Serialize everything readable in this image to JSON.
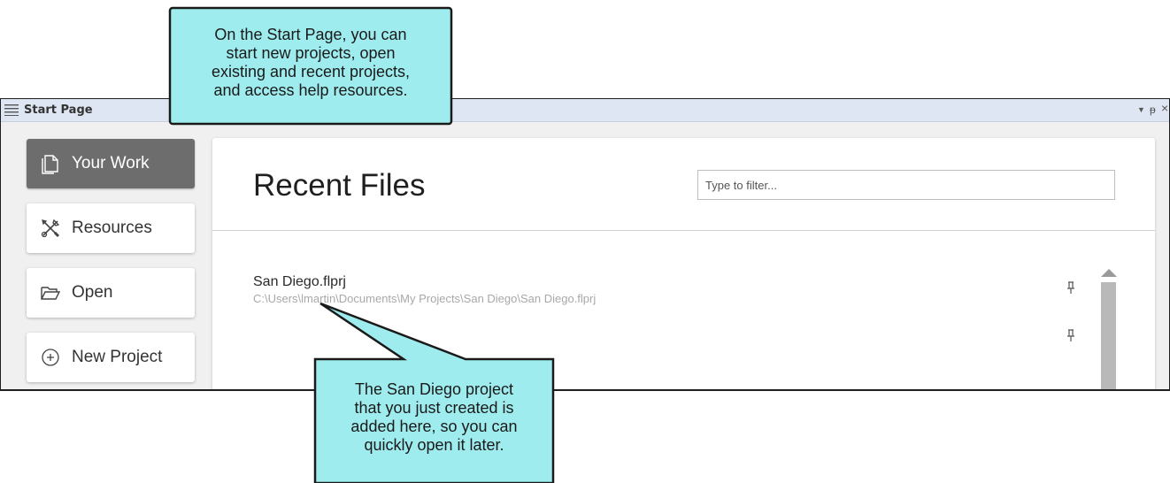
{
  "window": {
    "title": "Start Page",
    "controls": {
      "dropdown": "▼",
      "pin": "ᵽ",
      "close": "×"
    }
  },
  "sidebar": {
    "items": [
      {
        "label": "Your Work",
        "icon": "document-icon",
        "active": true
      },
      {
        "label": "Resources",
        "icon": "tools-icon",
        "active": false
      },
      {
        "label": "Open",
        "icon": "folder-open-icon",
        "active": false
      },
      {
        "label": "New Project",
        "icon": "plus-circle-icon",
        "active": false
      }
    ]
  },
  "main": {
    "title": "Recent Files",
    "filter_placeholder": "Type to filter...",
    "recent_files": [
      {
        "name": "San Diego.flprj",
        "path": "C:\\Users\\lmartin\\Documents\\My Projects\\San Diego\\San Diego.flprj"
      }
    ]
  },
  "callouts": {
    "top": {
      "lines": [
        "On the Start Page, you can",
        "start new projects, open",
        "existing and recent projects,",
        "and access help resources."
      ],
      "fill": "#9eecee"
    },
    "bottom": {
      "lines": [
        "The San Diego project",
        "that you just created is",
        "added here, so you can",
        "quickly open it later."
      ],
      "fill": "#9eecee"
    }
  },
  "colors": {
    "titlebar": "#dfe6f3",
    "active_nav": "#6d6d6d",
    "callout": "#9eecee"
  }
}
